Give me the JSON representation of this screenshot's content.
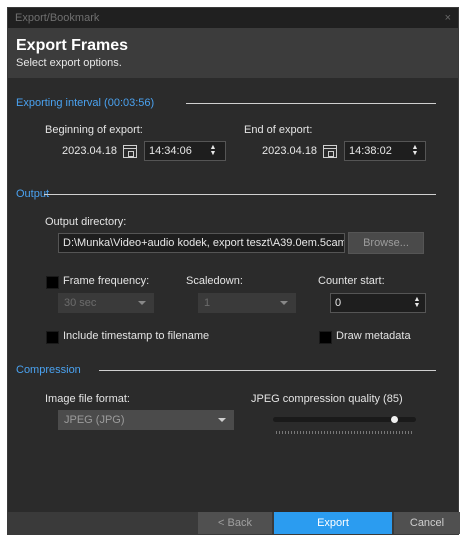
{
  "window": {
    "title": "Export/Bookmark",
    "close_glyph": "×"
  },
  "header": {
    "title": "Export Frames",
    "subtitle": "Select export options."
  },
  "interval": {
    "section_title": "Exporting interval (00:03:56)",
    "begin_label": "Beginning of export:",
    "begin_date": "2023.04.18",
    "begin_time": "14:34:06",
    "end_label": "End of export:",
    "end_date": "2023.04.18",
    "end_time": "14:38:02"
  },
  "output": {
    "section_title": "Output",
    "dir_label": "Output directory:",
    "dir_value": "D:\\Munka\\Video+audio kodek, export teszt\\A39.0em.5cam_",
    "browse_label": "Browse...",
    "frame_freq_label": "Frame frequency:",
    "frame_freq_value": "30 sec",
    "scaledown_label": "Scaledown:",
    "scaledown_value": "1",
    "counter_label": "Counter start:",
    "counter_value": "0",
    "timestamp_label": "Include timestamp to filename",
    "metadata_label": "Draw metadata"
  },
  "compression": {
    "section_title": "Compression",
    "format_label": "Image file format:",
    "format_value": "JPEG (JPG)",
    "quality_label": "JPEG compression quality (85)",
    "quality_value": 85
  },
  "footer": {
    "back_label": "< Back",
    "export_label": "Export",
    "cancel_label": "Cancel"
  },
  "colors": {
    "accent": "#2b9cf0",
    "section": "#4aa2f0",
    "background": "#2b2b2b"
  }
}
